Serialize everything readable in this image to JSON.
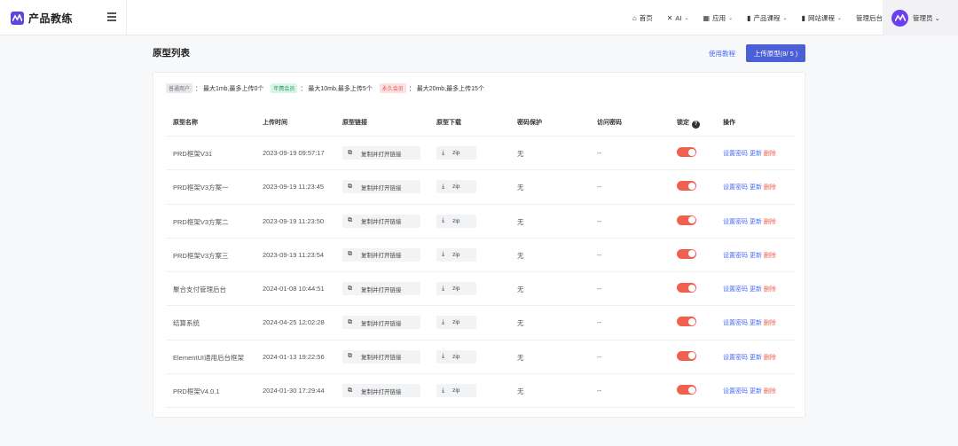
{
  "app": {
    "brand_name": "产品教练",
    "logo_color": "#5b47e0",
    "accent_color": "#4b5fd6"
  },
  "nav": {
    "items": [
      {
        "label": "首页",
        "icon": "home-icon",
        "glyph": "⌂",
        "has_dropdown": false
      },
      {
        "label": "AI",
        "icon": "tools-icon",
        "glyph": "✕",
        "has_dropdown": true
      },
      {
        "label": "应用",
        "icon": "grid-icon",
        "glyph": "▦",
        "has_dropdown": true
      },
      {
        "label": "产品课程",
        "icon": "book-icon",
        "glyph": "▮",
        "has_dropdown": true
      },
      {
        "label": "网站课程",
        "icon": "book-icon",
        "glyph": "▮",
        "has_dropdown": true
      },
      {
        "label": "管理后台",
        "icon": "",
        "glyph": "",
        "has_dropdown": false
      }
    ],
    "admin_label": "管理员"
  },
  "page": {
    "title": "原型列表",
    "help_link": "使用教程",
    "upload_button": "上传原型(8/ 5 )"
  },
  "quota": {
    "normal_tag": "普通用户",
    "normal_text": "： 最大1mb,最多上传0个",
    "year_tag": "年费会员",
    "year_text": "： 最大10mb,最多上传5个",
    "life_tag": "永久会员",
    "life_text": "： 最大20mb,最多上传15个"
  },
  "table": {
    "columns": [
      "原型名称",
      "上传时间",
      "原型链接",
      "原型下载",
      "密码保护",
      "访问密码",
      "锁定",
      "操作"
    ],
    "copy_label": "复制并打开链接",
    "zip_label": "zip",
    "op_set_password": "设置密码",
    "op_update": "更新",
    "op_delete": "删除",
    "rows": [
      {
        "name": "PRD框架V31",
        "time": "2023-09-19 09:57:17",
        "password_protect": "无",
        "access_password": "--",
        "locked": true
      },
      {
        "name": "PRD框架V3方案一",
        "time": "2023-09-19 11:23:45",
        "password_protect": "无",
        "access_password": "--",
        "locked": true
      },
      {
        "name": "PRD框架V3方案二",
        "time": "2023-09-19 11:23:50",
        "password_protect": "无",
        "access_password": "--",
        "locked": true
      },
      {
        "name": "PRD框架V3方案三",
        "time": "2023-09-19 11:23:54",
        "password_protect": "无",
        "access_password": "--",
        "locked": true
      },
      {
        "name": "聚合支付管理后台",
        "time": "2024-01-08 10:44:51",
        "password_protect": "无",
        "access_password": "--",
        "locked": true
      },
      {
        "name": "结算系统",
        "time": "2024-04-25 12:02:28",
        "password_protect": "无",
        "access_password": "--",
        "locked": true
      },
      {
        "name": "ElementUI通用后台框架",
        "time": "2024-01-13 19:22:56",
        "password_protect": "无",
        "access_password": "--",
        "locked": true
      },
      {
        "name": "PRD框架V4.0.1",
        "time": "2024-01-30 17:29:44",
        "password_protect": "无",
        "access_password": "--",
        "locked": true
      }
    ]
  }
}
